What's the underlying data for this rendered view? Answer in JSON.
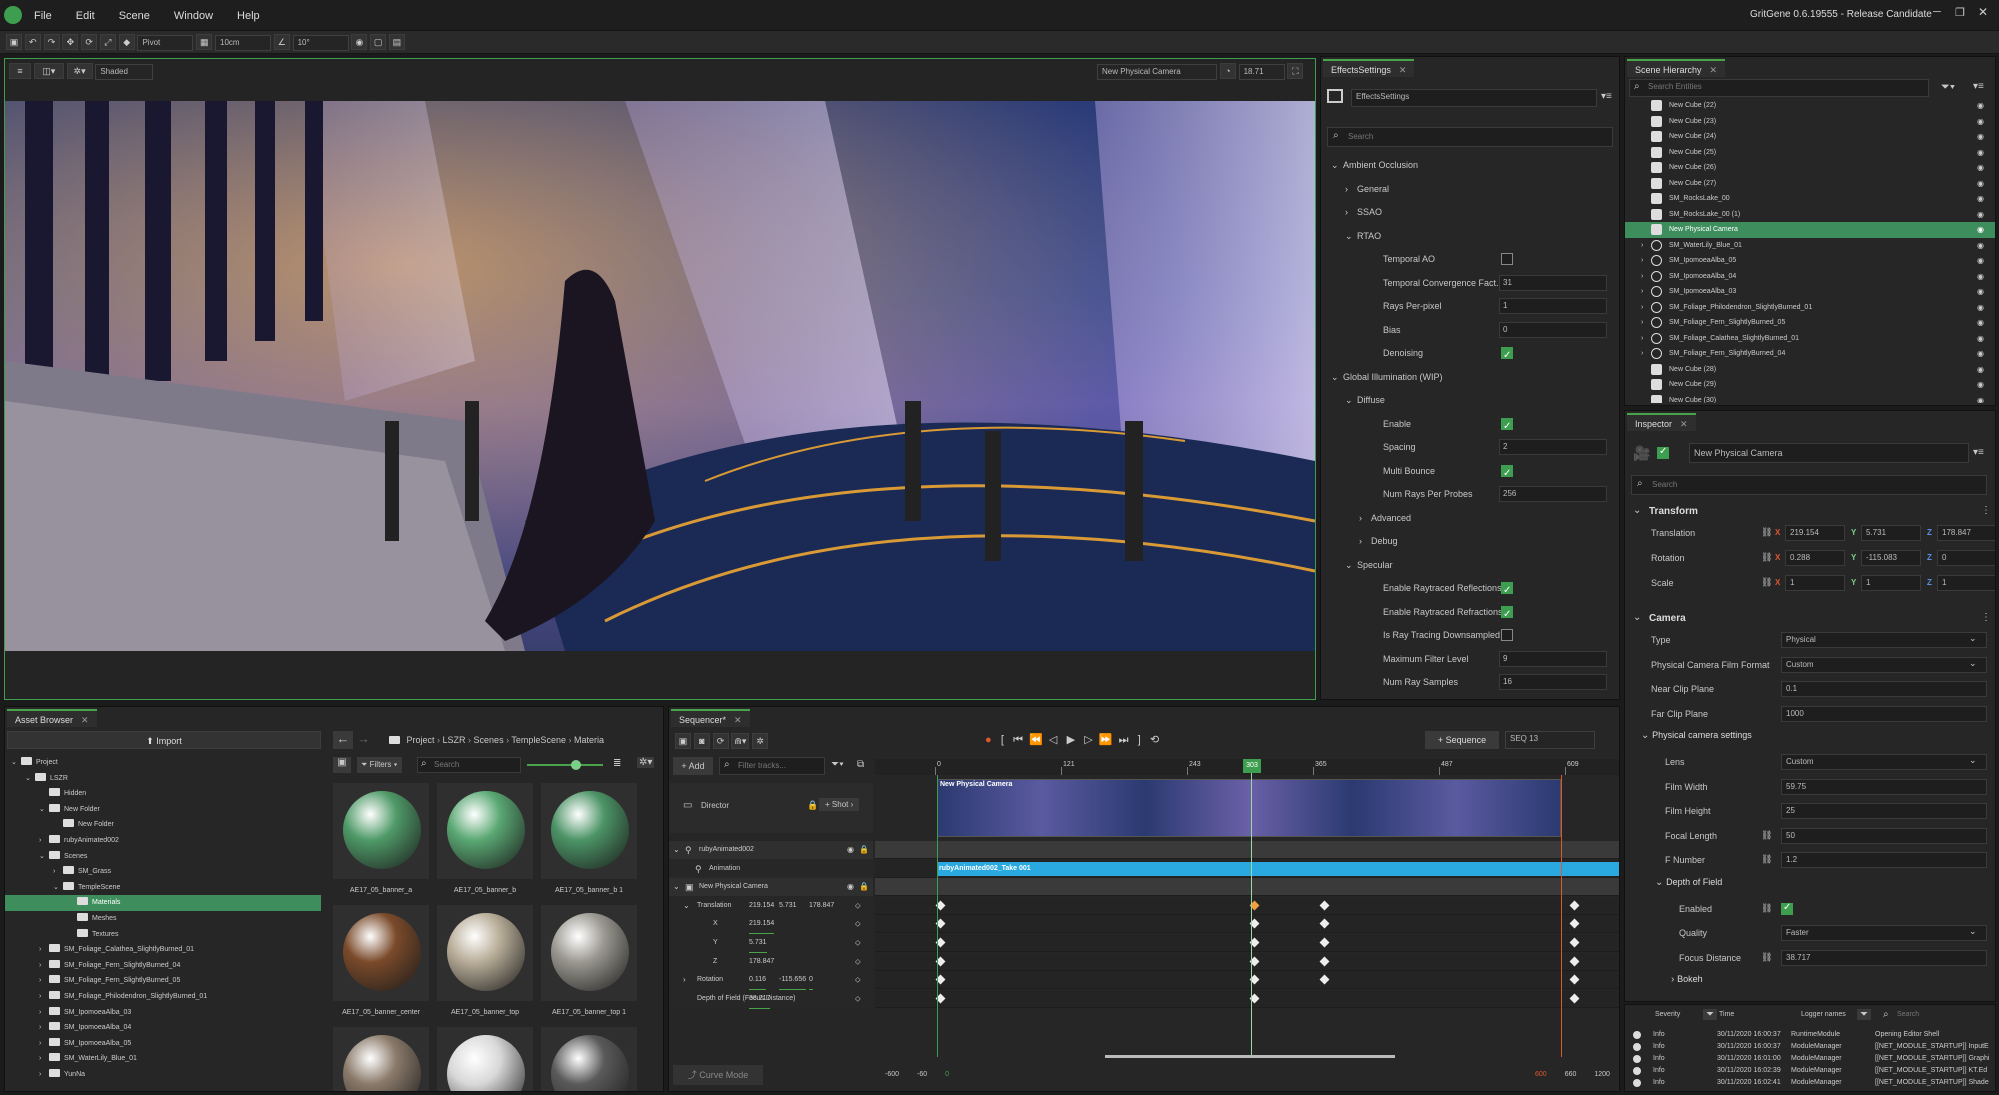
{
  "app": {
    "menu": [
      "File",
      "Edit",
      "Scene",
      "Window",
      "Help"
    ],
    "title": "GritGene 0.6.19555 - Release Candidate"
  },
  "toolbar": {
    "pivot": "Pivot",
    "grid": "10cm",
    "angle": "10°"
  },
  "viewport": {
    "mode": "Shaded",
    "camera": "New Physical Camera",
    "fov": "18.71"
  },
  "effects": {
    "tab": "EffectsSettings",
    "name": "EffectsSettings",
    "search_placeholder": "Search",
    "rows": [
      {
        "depth": 0,
        "arrow": "v",
        "label": "Ambient Occlusion"
      },
      {
        "depth": 1,
        "arrow": ">",
        "label": "General"
      },
      {
        "depth": 1,
        "arrow": ">",
        "label": "SSAO"
      },
      {
        "depth": 1,
        "arrow": "v",
        "label": "RTAO"
      },
      {
        "depth": 2,
        "label": "Temporal AO",
        "type": "check",
        "checked": false
      },
      {
        "depth": 2,
        "label": "Temporal Convergence Fact...",
        "type": "num",
        "value": "31"
      },
      {
        "depth": 2,
        "label": "Rays Per-pixel",
        "type": "num",
        "value": "1"
      },
      {
        "depth": 2,
        "label": "Bias",
        "type": "num",
        "value": "0"
      },
      {
        "depth": 2,
        "label": "Denoising",
        "type": "check",
        "checked": true
      },
      {
        "depth": 0,
        "arrow": "v",
        "label": "Global Illumination (WIP)"
      },
      {
        "depth": 1,
        "arrow": "v",
        "label": "Diffuse"
      },
      {
        "depth": 2,
        "label": "Enable",
        "type": "check",
        "checked": true
      },
      {
        "depth": 2,
        "label": "Spacing",
        "type": "num",
        "value": "2"
      },
      {
        "depth": 2,
        "label": "Multi Bounce",
        "type": "check",
        "checked": true
      },
      {
        "depth": 2,
        "label": "Num Rays Per Probes",
        "type": "num",
        "value": "256"
      },
      {
        "depth": 2,
        "arrow": ">",
        "label": "Advanced"
      },
      {
        "depth": 2,
        "arrow": ">",
        "label": "Debug"
      },
      {
        "depth": 1,
        "arrow": "v",
        "label": "Specular"
      },
      {
        "depth": 2,
        "label": "Enable Raytraced Reflections",
        "type": "check",
        "checked": true
      },
      {
        "depth": 2,
        "label": "Enable Raytraced Refractions",
        "type": "check",
        "checked": true
      },
      {
        "depth": 2,
        "label": "Is Ray Tracing Downsampled",
        "type": "check",
        "checked": false
      },
      {
        "depth": 2,
        "label": "Maximum Filter Level",
        "type": "num",
        "value": "9"
      },
      {
        "depth": 2,
        "label": "Num Ray Samples",
        "type": "num",
        "value": "16"
      }
    ]
  },
  "hierarchy": {
    "tab": "Scene Hierarchy",
    "search_placeholder": "Search Entities",
    "items": [
      {
        "label": "New Cube (22)",
        "kind": "cube"
      },
      {
        "label": "New Cube (23)",
        "kind": "cube"
      },
      {
        "label": "New Cube (24)",
        "kind": "cube"
      },
      {
        "label": "New Cube (25)",
        "kind": "cube"
      },
      {
        "label": "New Cube (26)",
        "kind": "cube"
      },
      {
        "label": "New Cube (27)",
        "kind": "cube"
      },
      {
        "label": "SM_RocksLake_00",
        "kind": "cube"
      },
      {
        "label": "SM_RocksLake_00 (1)",
        "kind": "cube"
      },
      {
        "label": "New Physical Camera",
        "kind": "camera",
        "selected": true
      },
      {
        "label": "SM_WaterLily_Blue_01",
        "kind": "ring",
        "arrow": true
      },
      {
        "label": "SM_IpomoeaAlba_05",
        "kind": "ring",
        "arrow": true
      },
      {
        "label": "SM_IpomoeaAlba_04",
        "kind": "ring",
        "arrow": true
      },
      {
        "label": "SM_IpomoeaAlba_03",
        "kind": "ring",
        "arrow": true
      },
      {
        "label": "SM_Foliage_Philodendron_SlightlyBurned_01",
        "kind": "ring",
        "arrow": true
      },
      {
        "label": "SM_Foliage_Fern_SlightlyBurned_05",
        "kind": "ring",
        "arrow": true
      },
      {
        "label": "SM_Foliage_Calathea_SlightlyBurned_01",
        "kind": "ring",
        "arrow": true
      },
      {
        "label": "SM_Foliage_Fern_SlightlyBurned_04",
        "kind": "ring",
        "arrow": true
      },
      {
        "label": "New Cube (28)",
        "kind": "cube"
      },
      {
        "label": "New Cube (29)",
        "kind": "cube"
      },
      {
        "label": "New Cube (30)",
        "kind": "cube"
      }
    ]
  },
  "inspector": {
    "tab": "Inspector",
    "entity_name": "New Physical Camera",
    "search_placeholder": "Search",
    "transform": {
      "title": "Transform",
      "rows": [
        {
          "label": "Translation",
          "x": "219.154",
          "y": "5.731",
          "z": "178.847"
        },
        {
          "label": "Rotation",
          "x": "0.288",
          "y": "-115.083",
          "z": "0"
        },
        {
          "label": "Scale",
          "x": "1",
          "y": "1",
          "z": "1"
        }
      ]
    },
    "camera": {
      "title": "Camera",
      "rows": [
        {
          "label": "Type",
          "value": "Physical",
          "dd": true
        },
        {
          "label": "Physical Camera Film Format",
          "value": "Custom",
          "dd": true
        },
        {
          "label": "Near Clip Plane",
          "value": "0.1"
        },
        {
          "label": "Far Clip Plane",
          "value": "1000"
        }
      ],
      "phys_title": "Physical camera settings",
      "phys_rows": [
        {
          "label": "Lens",
          "value": "Custom",
          "dd": true
        },
        {
          "label": "Film Width",
          "value": "59.75"
        },
        {
          "label": "Film Height",
          "value": "25"
        },
        {
          "label": "Focal Length",
          "value": "50"
        },
        {
          "label": "F Number",
          "value": "1.2"
        }
      ],
      "dof_title": "Depth of Field",
      "dof_rows": [
        {
          "label": "Enabled",
          "check": true
        },
        {
          "label": "Quality",
          "value": "Faster",
          "dd": true
        },
        {
          "label": "Focus Distance",
          "value": "38.717"
        }
      ],
      "bokeh": "Bokeh"
    }
  },
  "log": {
    "headers": [
      "Severity",
      "Time",
      "Logger names"
    ],
    "search_placeholder": "Search",
    "rows": [
      {
        "sev": "Info",
        "time": "30/11/2020 16:00:37",
        "logger": "RuntimeModule",
        "msg": "Opening Editor Shell"
      },
      {
        "sev": "Info",
        "time": "30/11/2020 16:00:37",
        "logger": "ModuleManager",
        "msg": "[[NET_MODULE_STARTUP]] InputE"
      },
      {
        "sev": "Info",
        "time": "30/11/2020 16:01:00",
        "logger": "ModuleManager",
        "msg": "[[NET_MODULE_STARTUP]] Graphi"
      },
      {
        "sev": "Info",
        "time": "30/11/2020 16:02:39",
        "logger": "ModuleManager",
        "msg": "[[NET_MODULE_STARTUP]] KT.Ed"
      },
      {
        "sev": "Info",
        "time": "30/11/2020 16:02:41",
        "logger": "ModuleManager",
        "msg": "[[NET_MODULE_STARTUP]] Shade"
      }
    ]
  },
  "assets": {
    "tab": "Asset Browser",
    "import": "Import",
    "filters": "Filters",
    "search_placeholder": "Search",
    "breadcrumb": [
      "Project",
      "LSZR",
      "Scenes",
      "TempleScene",
      "Materia"
    ],
    "tree": [
      {
        "depth": 0,
        "arrow": "v",
        "label": "Project"
      },
      {
        "depth": 1,
        "arrow": "v",
        "label": "LSZR"
      },
      {
        "depth": 2,
        "label": "Hidden"
      },
      {
        "depth": 2,
        "arrow": "v",
        "label": "New Folder"
      },
      {
        "depth": 3,
        "label": "New Folder"
      },
      {
        "depth": 2,
        "arrow": ">",
        "label": "rubyAnimated002"
      },
      {
        "depth": 2,
        "arrow": "v",
        "label": "Scenes"
      },
      {
        "depth": 3,
        "arrow": ">",
        "label": "SM_Grass"
      },
      {
        "depth": 3,
        "arrow": "v",
        "label": "TempleScene"
      },
      {
        "depth": 4,
        "label": "Materials",
        "selected": true
      },
      {
        "depth": 4,
        "label": "Meshes"
      },
      {
        "depth": 4,
        "label": "Textures"
      },
      {
        "depth": 2,
        "arrow": ">",
        "label": "SM_Foliage_Calathea_SlightlyBurned_01"
      },
      {
        "depth": 2,
        "arrow": ">",
        "label": "SM_Foliage_Fern_SlightlyBurned_04"
      },
      {
        "depth": 2,
        "arrow": ">",
        "label": "SM_Foliage_Fern_SlightlyBurned_05"
      },
      {
        "depth": 2,
        "arrow": ">",
        "label": "SM_Foliage_Philodendron_SlightlyBurned_01"
      },
      {
        "depth": 2,
        "arrow": ">",
        "label": "SM_IpomoeaAlba_03"
      },
      {
        "depth": 2,
        "arrow": ">",
        "label": "SM_IpomoeaAlba_04"
      },
      {
        "depth": 2,
        "arrow": ">",
        "label": "SM_IpomoeaAlba_05"
      },
      {
        "depth": 2,
        "arrow": ">",
        "label": "SM_WaterLily_Blue_01"
      },
      {
        "depth": 2,
        "arrow": ">",
        "label": "YunNa"
      }
    ],
    "thumbs": [
      {
        "label": "AE17_05_banner_a",
        "color": "#4f9a68"
      },
      {
        "label": "AE17_05_banner_b",
        "color": "#5aa873"
      },
      {
        "label": "AE17_05_banner_b 1",
        "color": "#4c9466"
      },
      {
        "label": "AE17_05_banner_center",
        "color": "#7a4a2a"
      },
      {
        "label": "AE17_05_banner_top",
        "color": "#b8ad98"
      },
      {
        "label": "AE17_05_banner_top 1",
        "color": "#9a9890"
      },
      {
        "label": "",
        "color": "#8a7a6a"
      },
      {
        "label": "",
        "color": "#d8d8d8"
      },
      {
        "label": "",
        "color": "#5a5a5a"
      }
    ]
  },
  "sequencer": {
    "tab": "Sequencer*",
    "add": "Add",
    "filter_placeholder": "Filter tracks...",
    "sequence_btn": "Sequence",
    "seq_select": "SEQ 13",
    "ruler": [
      "0",
      "121",
      "243",
      "365",
      "487",
      "609"
    ],
    "playhead": "303",
    "director": "Director",
    "shot": "Shot",
    "tracks": [
      {
        "label": "rubyAnimated002",
        "depth": 0,
        "arrow": "v",
        "icon": "anim"
      },
      {
        "label": "Animation",
        "depth": 1,
        "icon": "anim"
      },
      {
        "label": "New Physical Camera",
        "depth": 0,
        "arrow": "v",
        "icon": "camera"
      },
      {
        "label": "Translation",
        "depth": 1,
        "arrow": "v",
        "v1": "219.154",
        "v2": "5.731",
        "v3": "178.847"
      },
      {
        "label": "X",
        "depth": 2,
        "v1": "219.154"
      },
      {
        "label": "Y",
        "depth": 2,
        "v1": "5.731"
      },
      {
        "label": "Z",
        "depth": 2,
        "v1": "178.847"
      },
      {
        "label": "Rotation",
        "depth": 1,
        "arrow": ">",
        "v1": "0.116",
        "v2": "-115.656",
        "v3": "0"
      },
      {
        "label": "Depth of Field (Focus Distance)",
        "depth": 1,
        "v1": "38.717"
      }
    ],
    "shot_label": "New Physical Camera",
    "anim_clip": "rubyAnimated002_Take 001",
    "curve_mode": "Curve Mode",
    "bottom_left": [
      "-600",
      "-60",
      "0"
    ],
    "bottom_right": [
      "600",
      "660",
      "1200"
    ]
  }
}
